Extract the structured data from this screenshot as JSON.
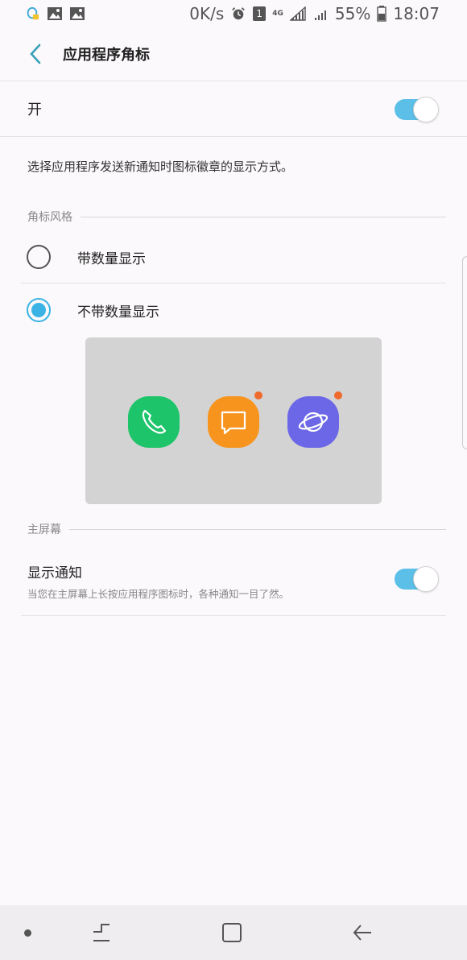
{
  "status_bar": {
    "speed": "0K/s",
    "battery": "55%",
    "time": "18:07",
    "sim_badge": "1",
    "network": "4G",
    "icons": [
      "qq-icon",
      "image-icon",
      "image-icon",
      "alarm-icon",
      "sim-icon",
      "signal-icon",
      "signal-icon",
      "battery-icon"
    ]
  },
  "header": {
    "title": "应用程序角标"
  },
  "master": {
    "label": "开",
    "enabled": true
  },
  "description": "选择应用程序发送新通知时图标徽章的显示方式。",
  "badge_style": {
    "section_title": "角标风格",
    "options": [
      {
        "label": "带数量显示",
        "selected": false
      },
      {
        "label": "不带数量显示",
        "selected": true
      }
    ],
    "preview_icons": [
      {
        "name": "phone-app-icon",
        "color": "#1dc46a",
        "badge": false
      },
      {
        "name": "messages-app-icon",
        "color": "#f7941d",
        "badge": true
      },
      {
        "name": "internet-app-icon",
        "color": "#6c67e6",
        "badge": true
      }
    ],
    "badge_color": "#ee6a2e"
  },
  "home_screen": {
    "section_title": "主屏幕",
    "show_notifications": {
      "title": "显示通知",
      "subtitle": "当您在主屏幕上长按应用程序图标时，各种通知一目了然。",
      "enabled": true
    }
  },
  "colors": {
    "accent": "#3ab3e4",
    "switch_track": "#5bbfe8",
    "background": "#fcf9fc"
  }
}
